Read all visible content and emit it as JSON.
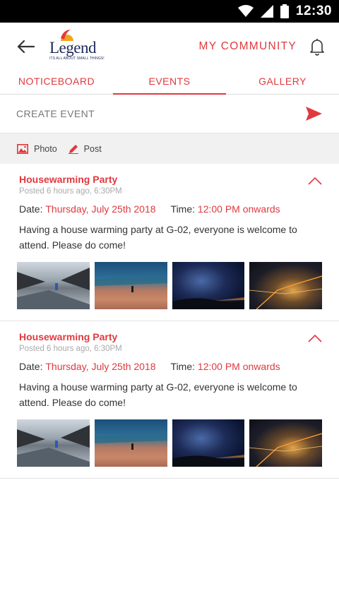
{
  "status_bar": {
    "time": "12:30"
  },
  "app_bar": {
    "logo_text": "Legend",
    "logo_tagline": "ITS ALL ABOUT SMALL THINGS!",
    "title": "MY COMMUNITY"
  },
  "tabs": [
    {
      "label": "NOTICEBOARD",
      "active": false
    },
    {
      "label": "EVENTS",
      "active": true
    },
    {
      "label": "GALLERY",
      "active": false
    }
  ],
  "create_event": {
    "label": "CREATE EVENT"
  },
  "actions": {
    "photo_label": "Photo",
    "post_label": "Post"
  },
  "events": [
    {
      "title": "Housewarming Party",
      "posted": "Posted 6 hours ago, 6:30PM",
      "date_label": "Date: ",
      "date_value": "Thursday, July 25th 2018",
      "time_label": "Time: ",
      "time_value": "12:00 PM onwards",
      "description": "Having a house warming party at G-02, everyone is welcome to attend. Please do come!"
    },
    {
      "title": "Housewarming Party",
      "posted": "Posted 6 hours ago, 6:30PM",
      "date_label": "Date: ",
      "date_value": "Thursday, July 25th 2018",
      "time_label": "Time: ",
      "time_value": "12:00 PM onwards",
      "description": "Having a house warming party at G-02, everyone is welcome to attend. Please do come!"
    }
  ],
  "colors": {
    "accent": "#e0393e",
    "brand_navy": "#1d2a5a"
  }
}
